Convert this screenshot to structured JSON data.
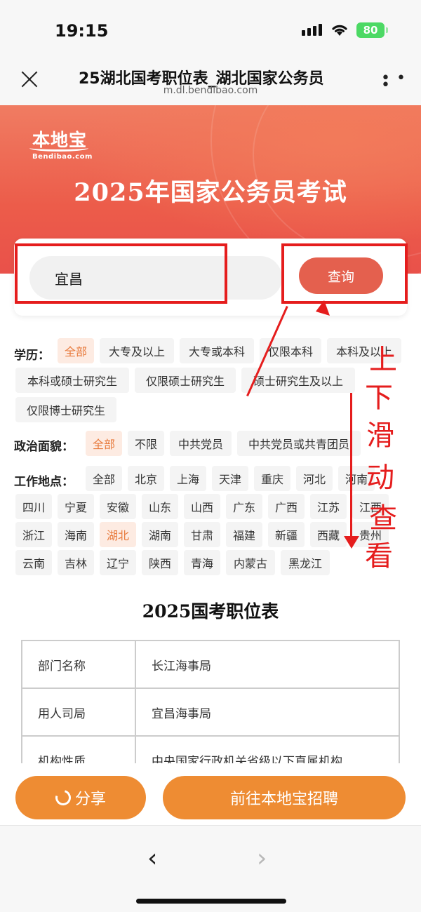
{
  "status_bar": {
    "time": "19:15",
    "battery": "80"
  },
  "nav": {
    "title": "25湖北国考职位表_湖北国家公务员",
    "url": "m.dl.bendibao.com"
  },
  "banner": {
    "logo_main": "本地宝",
    "logo_sub": "Bendibao.com",
    "title": "2025年国家公务员考试"
  },
  "search": {
    "value": "宜昌",
    "button_label": "查询"
  },
  "filters": {
    "education": {
      "label": "学历：",
      "options": [
        "全部",
        "大专及以上",
        "大专或本科",
        "仅限本科",
        "本科及以上",
        "本科或硕士研究生",
        "仅限硕士研究生",
        "硕士研究生及以上",
        "仅限博士研究生"
      ],
      "selected": "全部"
    },
    "political": {
      "label": "政治面貌：",
      "options": [
        "全部",
        "不限",
        "中共党员",
        "中共党员或共青团员"
      ],
      "selected": "全部"
    },
    "location": {
      "label": "工作地点：",
      "options": [
        "全部",
        "北京",
        "上海",
        "天津",
        "重庆",
        "河北",
        "河南",
        "四川",
        "宁夏",
        "安徽",
        "山东",
        "山西",
        "广东",
        "广西",
        "江苏",
        "江西",
        "浙江",
        "海南",
        "湖北",
        "湖南",
        "甘肃",
        "福建",
        "新疆",
        "西藏",
        "贵州",
        "云南",
        "吉林",
        "辽宁",
        "陕西",
        "青海",
        "内蒙古",
        "黑龙江"
      ],
      "selected": "湖北"
    }
  },
  "annotation": {
    "text": [
      "上",
      "下",
      "滑",
      "动",
      "查",
      "看"
    ]
  },
  "table": {
    "title": "2025国考职位表",
    "rows": [
      {
        "key": "部门名称",
        "value": "长江海事局"
      },
      {
        "key": "用人司局",
        "value": "宜昌海事局"
      },
      {
        "key": "机构性质",
        "value": "中央国家行政机关省级以下直属机构"
      }
    ]
  },
  "actions": {
    "share_label": "分享",
    "recruit_label": "前往本地宝招聘"
  },
  "browser": {
    "back": "‹",
    "forward": "›"
  },
  "colors": {
    "accent": "#ee8c33",
    "banner": "#ec5c4a",
    "search_button": "#e4604e",
    "annotation": "#e51d1d",
    "chip_active": "#e87a3c"
  }
}
